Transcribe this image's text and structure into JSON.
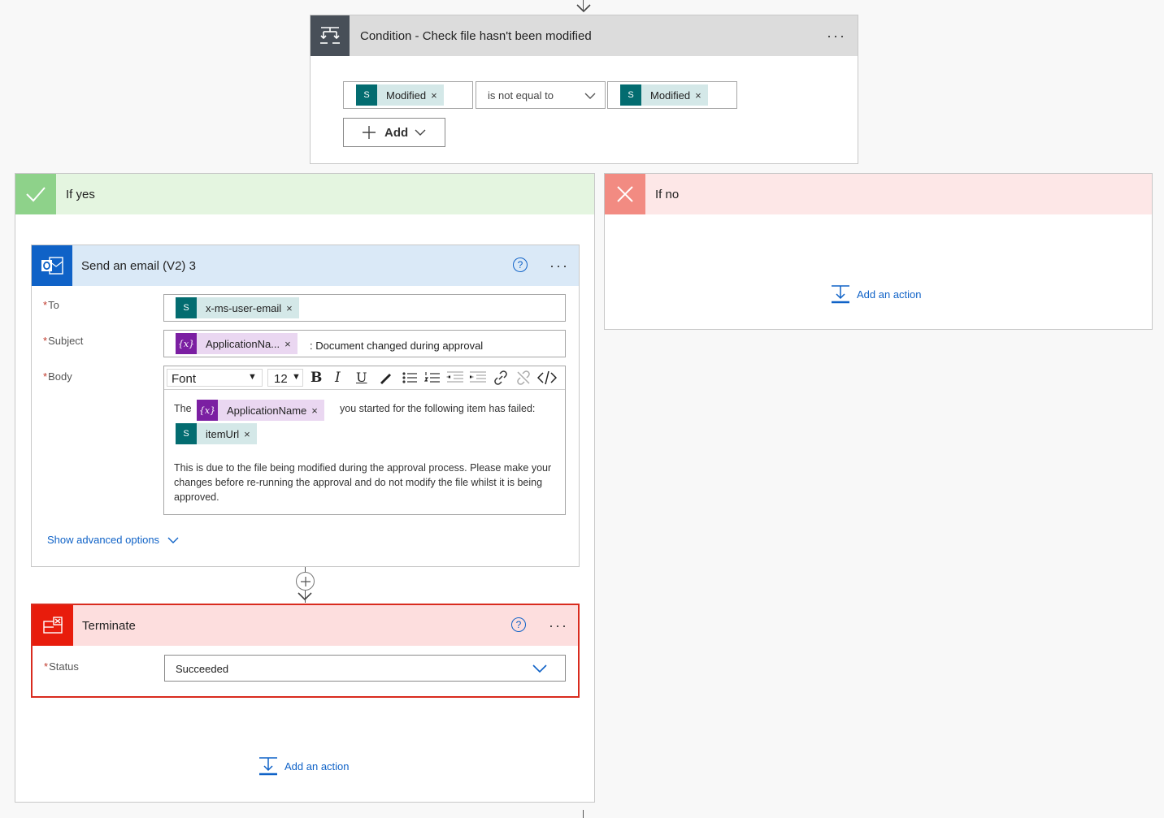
{
  "condition": {
    "title": "Condition - Check file hasn't been modified",
    "left_token": "Modified",
    "operator": "is not equal to",
    "right_token": "Modified",
    "add_label": "Add",
    "more_label": "···"
  },
  "if_yes": {
    "label": "If yes",
    "add_action_label": "Add an action"
  },
  "if_no": {
    "label": "If no",
    "add_action_label": "Add an action"
  },
  "send_email": {
    "title": "Send an email (V2) 3",
    "help_icon": "?",
    "more_label": "···",
    "to_label": "To",
    "to_token": "x-ms-user-email",
    "subject_label": "Subject",
    "subject_token": "ApplicationNa...",
    "subject_suffix": ": Document changed during approval",
    "body_label": "Body",
    "toolbar": {
      "font": "Font",
      "size": "12"
    },
    "body": {
      "prefix": "The",
      "token_app": "ApplicationName",
      "mid": "you started for the following item has failed:",
      "token_item": "itemUrl",
      "paragraph": "This is due to the file being modified during the approval process. Please make your changes before re-running the approval and do not modify the file whilst it is being approved."
    },
    "advanced_label": "Show advanced options"
  },
  "terminate": {
    "title": "Terminate",
    "help_icon": "?",
    "more_label": "···",
    "status_label": "Status",
    "status_value": "Succeeded"
  },
  "colors": {
    "condition_header": "#dcdcdc",
    "yes_header": "#e4f5e0",
    "yes_icon": "#8ed28a",
    "no_header": "#fde7e7",
    "no_icon": "#f28b82",
    "email_header": "#dae9f7",
    "outlook": "#0f62c7",
    "terminate_header": "#fddede",
    "terminate_icon": "#e81c0c",
    "link": "#0f62c7"
  }
}
